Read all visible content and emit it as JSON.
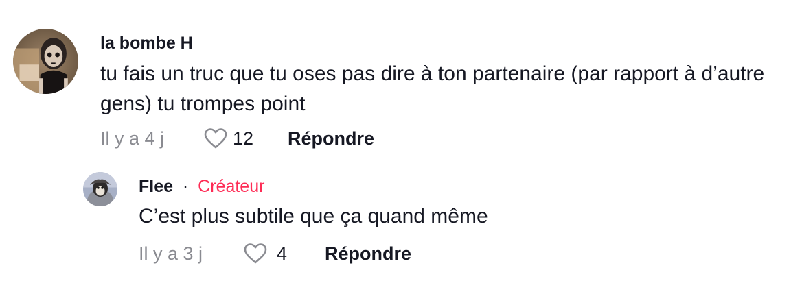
{
  "comments": [
    {
      "username": "la bombe H",
      "text": "tu fais un truc que tu oses pas dire à ton partenaire (par rapport à d’autre gens) tu trompes point",
      "time": "Il y a 4 j",
      "likes": "12",
      "reply_label": "Répondre"
    },
    {
      "username": "Flee",
      "separator": "·",
      "badge": "Créateur",
      "text": "C’est plus subtile que ça quand même",
      "time": "Il y a 3 j",
      "likes": "4",
      "reply_label": "Répondre"
    }
  ],
  "icons": {
    "like": "heart-outline-icon"
  },
  "colors": {
    "text_primary": "#161823",
    "text_secondary": "#8a8b91",
    "creator_badge": "#fe2c55",
    "background": "#ffffff"
  }
}
